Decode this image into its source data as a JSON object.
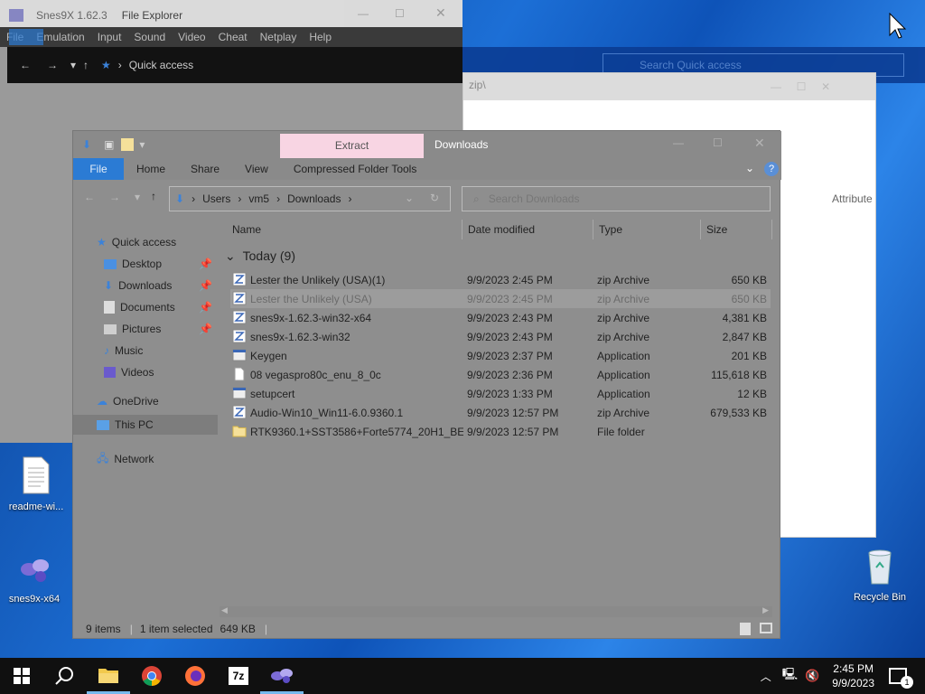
{
  "desktop": {
    "icons": [
      {
        "id": "readme",
        "label": "readme-wi..."
      },
      {
        "id": "snes9x",
        "label": "snes9x-x64"
      },
      {
        "id": "recycle",
        "label": "Recycle Bin"
      }
    ]
  },
  "snes_window": {
    "title": "Snes9X 1.62.3",
    "menu": [
      "File",
      "Emulation",
      "Input",
      "Sound",
      "Video",
      "Cheat",
      "Netplay",
      "Help"
    ],
    "overlay_title": "File Explorer",
    "overlay_tabs": [
      "File",
      "Home",
      "Share",
      "View"
    ],
    "nav_location": "Quick access"
  },
  "ghost_window": {
    "search_placeholder": "Search Quick access",
    "title_fragment": "zip\\",
    "column_fragment": "Attribute"
  },
  "explorer": {
    "title": "Downloads",
    "context_tab": "Extract",
    "ribbon_tabs": [
      "File",
      "Home",
      "Share",
      "View",
      "Compressed Folder Tools"
    ],
    "breadcrumb": [
      "Users",
      "vm5",
      "Downloads"
    ],
    "search_placeholder": "Search Downloads",
    "nav": {
      "quick_access": "Quick access",
      "pinned": [
        "Desktop",
        "Downloads",
        "Documents",
        "Pictures"
      ],
      "music": "Music",
      "videos": "Videos",
      "onedrive": "OneDrive",
      "this_pc": "This PC",
      "network": "Network"
    },
    "columns": {
      "name": "Name",
      "date": "Date modified",
      "type": "Type",
      "size": "Size"
    },
    "group_label": "Today (9)",
    "files": [
      {
        "name": "Lester the Unlikely (USA)(1)",
        "date": "9/9/2023 2:45 PM",
        "type": "zip Archive",
        "size": "650 KB",
        "icon": "zip-icon"
      },
      {
        "name": "Lester the Unlikely (USA)",
        "date": "9/9/2023 2:45 PM",
        "type": "zip Archive",
        "size": "650 KB",
        "icon": "zip-icon",
        "selected": true
      },
      {
        "name": "snes9x-1.62.3-win32-x64",
        "date": "9/9/2023 2:43 PM",
        "type": "zip Archive",
        "size": "4,381 KB",
        "icon": "zip-icon"
      },
      {
        "name": "snes9x-1.62.3-win32",
        "date": "9/9/2023 2:43 PM",
        "type": "zip Archive",
        "size": "2,847 KB",
        "icon": "zip-icon"
      },
      {
        "name": "Keygen",
        "date": "9/9/2023 2:37 PM",
        "type": "Application",
        "size": "201 KB",
        "icon": "app-icon"
      },
      {
        "name": "08 vegaspro80c_enu_8_0c",
        "date": "9/9/2023 2:36 PM",
        "type": "Application",
        "size": "115,618 KB",
        "icon": "blank-file-icon"
      },
      {
        "name": "setupcert",
        "date": "9/9/2023 1:33 PM",
        "type": "Application",
        "size": "12 KB",
        "icon": "app-icon"
      },
      {
        "name": "Audio-Win10_Win11-6.0.9360.1",
        "date": "9/9/2023 12:57 PM",
        "type": "zip Archive",
        "size": "679,533 KB",
        "icon": "zip-icon"
      },
      {
        "name": "RTK9360.1+SST3586+Forte5774_20H1_BE",
        "date": "9/9/2023 12:57 PM",
        "type": "File folder",
        "size": "",
        "icon": "folder-icon"
      }
    ],
    "status": {
      "count": "9 items",
      "selected": "1 item selected",
      "size": "649 KB"
    }
  },
  "taskbar": {
    "apps": [
      "start",
      "search",
      "file-explorer",
      "chrome",
      "firefox",
      "7zip",
      "snes9x"
    ],
    "time": "2:45 PM",
    "date": "9/9/2023",
    "notification_count": "1"
  }
}
